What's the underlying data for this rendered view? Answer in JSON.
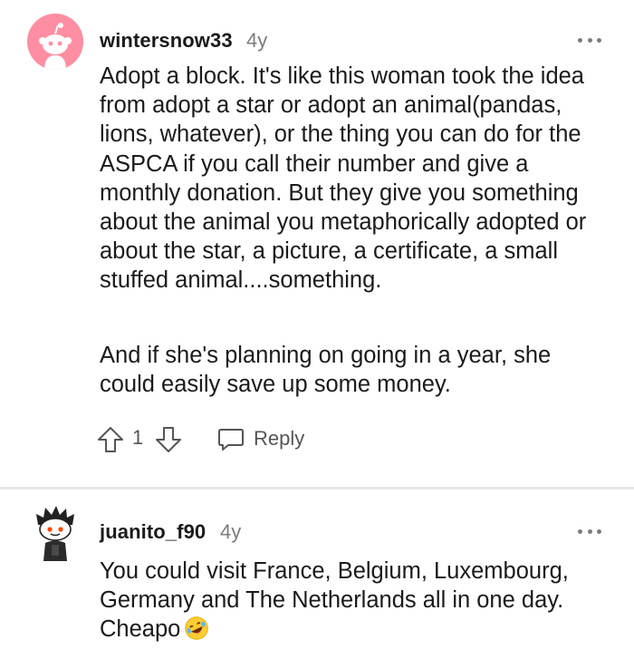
{
  "comments": [
    {
      "username": "wintersnow33",
      "age": "4y",
      "avatar": "reddit-snoo-avatar-pink",
      "paragraphs": [
        "Adopt a block. It's like this woman took the idea from adopt a star or adopt an animal(pandas, lions, whatever), or the thing you can do for the ASPCA if you call their number and give a monthly donation. But they give you something about the animal you metaphorically adopted or about the star, a picture, a certificate, a small stuffed animal....something.",
        "And if she's planning on going in a year, she could easily save up some money."
      ],
      "score": "1",
      "reply_label": "Reply"
    },
    {
      "username": "juanito_f90",
      "age": "4y",
      "avatar": "reddit-snoo-avatar-spiky-hair",
      "text": "You could visit France, Belgium, Luxembourg, Germany and The Netherlands all in one day. Cheapo",
      "emoji": "rolling-on-floor-laughing-emoji"
    }
  ],
  "icons": {
    "more": "more-horizontal-icon",
    "upvote": "upvote-arrow-icon",
    "downvote": "downvote-arrow-icon",
    "reply": "comment-bubble-icon"
  },
  "colors": {
    "avatar_bg": "#ff8ea2",
    "meta_gray": "#7c7c7c",
    "text": "#1a1a1b",
    "divider": "#e6e6e6"
  }
}
